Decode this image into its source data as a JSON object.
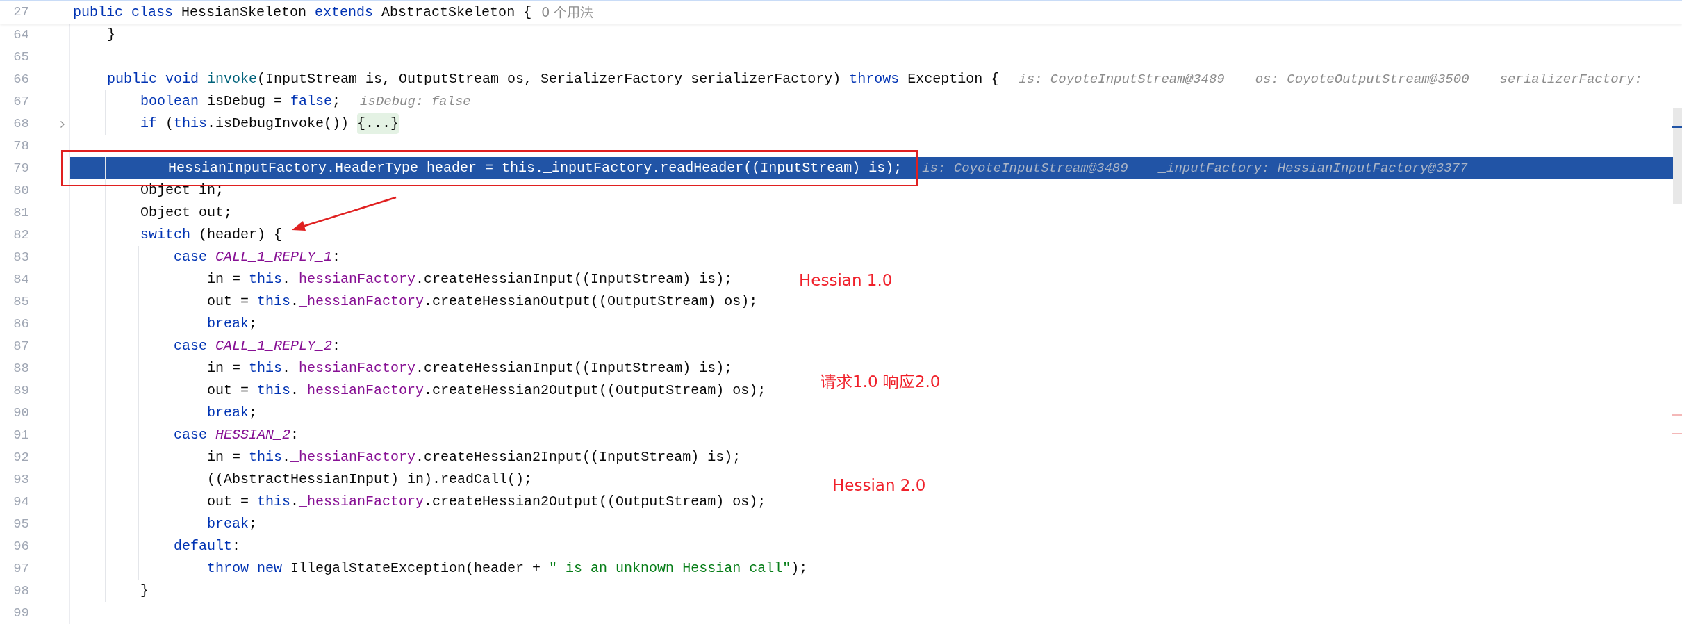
{
  "sticky_line": {
    "number": "27",
    "tokens": [
      {
        "kind": "kw",
        "text": "public class"
      },
      {
        "kind": "plain",
        "text": " HessianSkeleton "
      },
      {
        "kind": "kw",
        "text": "extends"
      },
      {
        "kind": "plain",
        "text": " AbstractSkeleton {"
      }
    ],
    "usages": "0 个用法"
  },
  "lines": [
    {
      "number": "64",
      "current": false,
      "foldable": false,
      "tokens": [
        {
          "kind": "plain",
          "text": "    }"
        }
      ]
    },
    {
      "number": "65",
      "current": false,
      "foldable": false
    },
    {
      "number": "66",
      "current": false,
      "foldable": false,
      "tokens": [
        {
          "kind": "kw",
          "text": "    public void "
        },
        {
          "kind": "decl",
          "text": "invoke"
        },
        {
          "kind": "plain",
          "text": "(InputStream is, OutputStream os, SerializerFactory serializerFactory) "
        },
        {
          "kind": "kw",
          "text": "throws"
        },
        {
          "kind": "plain",
          "text": " Exception {"
        }
      ],
      "hints": [
        "is: CoyoteInputStream@3489",
        "os: CoyoteOutputStream@3500",
        "serializerFactory:"
      ]
    },
    {
      "number": "67",
      "current": false,
      "foldable": false,
      "tokens": [
        {
          "kind": "kw",
          "text": "        boolean"
        },
        {
          "kind": "plain",
          "text": " isDebug = "
        },
        {
          "kind": "kw",
          "text": "false"
        },
        {
          "kind": "plain",
          "text": ";"
        }
      ],
      "hints": [
        "isDebug: false"
      ]
    },
    {
      "number": "68",
      "current": false,
      "foldable": true,
      "tokens": [
        {
          "kind": "kw",
          "text": "        if"
        },
        {
          "kind": "plain",
          "text": " ("
        },
        {
          "kind": "kw",
          "text": "this"
        },
        {
          "kind": "plain",
          "text": ".isDebugInvoke()) "
        },
        {
          "kind": "fold",
          "text": "{...}"
        }
      ]
    },
    {
      "number": "78",
      "current": false,
      "foldable": false
    },
    {
      "number": "79",
      "current": true,
      "foldable": false,
      "tokens": [
        {
          "kind": "plain",
          "text": "        HessianInputFactory.HeaderType header = "
        },
        {
          "kind": "kw",
          "text": "this"
        },
        {
          "kind": "plain",
          "text": "."
        },
        {
          "kind": "field",
          "text": "_inputFactory"
        },
        {
          "kind": "plain",
          "text": ".readHeader((InputStream) is);"
        }
      ],
      "hints": [
        "is: CoyoteInputStream@3489",
        "_inputFactory: HessianInputFactory@3377"
      ]
    },
    {
      "number": "80",
      "current": false,
      "foldable": false,
      "tokens": [
        {
          "kind": "plain",
          "text": "        Object in;"
        }
      ]
    },
    {
      "number": "81",
      "current": false,
      "foldable": false,
      "tokens": [
        {
          "kind": "plain",
          "text": "        Object out;"
        }
      ]
    },
    {
      "number": "82",
      "current": false,
      "foldable": false,
      "tokens": [
        {
          "kind": "kw",
          "text": "        switch"
        },
        {
          "kind": "plain",
          "text": " (header) {"
        }
      ]
    },
    {
      "number": "83",
      "current": false,
      "foldable": false,
      "tokens": [
        {
          "kind": "kw",
          "text": "            case "
        },
        {
          "kind": "const",
          "text": "CALL_1_REPLY_1"
        },
        {
          "kind": "plain",
          "text": ":"
        }
      ]
    },
    {
      "number": "84",
      "current": false,
      "foldable": false,
      "tokens": [
        {
          "kind": "plain",
          "text": "                in = "
        },
        {
          "kind": "kw",
          "text": "this"
        },
        {
          "kind": "plain",
          "text": "."
        },
        {
          "kind": "field",
          "text": "_hessianFactory"
        },
        {
          "kind": "plain",
          "text": ".createHessianInput((InputStream) is);"
        }
      ]
    },
    {
      "number": "85",
      "current": false,
      "foldable": false,
      "tokens": [
        {
          "kind": "plain",
          "text": "                out = "
        },
        {
          "kind": "kw",
          "text": "this"
        },
        {
          "kind": "plain",
          "text": "."
        },
        {
          "kind": "field",
          "text": "_hessianFactory"
        },
        {
          "kind": "plain",
          "text": ".createHessianOutput((OutputStream) os);"
        }
      ]
    },
    {
      "number": "86",
      "current": false,
      "foldable": false,
      "tokens": [
        {
          "kind": "kw",
          "text": "                break"
        },
        {
          "kind": "plain",
          "text": ";"
        }
      ]
    },
    {
      "number": "87",
      "current": false,
      "foldable": false,
      "tokens": [
        {
          "kind": "kw",
          "text": "            case "
        },
        {
          "kind": "const",
          "text": "CALL_1_REPLY_2"
        },
        {
          "kind": "plain",
          "text": ":"
        }
      ]
    },
    {
      "number": "88",
      "current": false,
      "foldable": false,
      "tokens": [
        {
          "kind": "plain",
          "text": "                in = "
        },
        {
          "kind": "kw",
          "text": "this"
        },
        {
          "kind": "plain",
          "text": "."
        },
        {
          "kind": "field",
          "text": "_hessianFactory"
        },
        {
          "kind": "plain",
          "text": ".createHessianInput((InputStream) is);"
        }
      ]
    },
    {
      "number": "89",
      "current": false,
      "foldable": false,
      "tokens": [
        {
          "kind": "plain",
          "text": "                out = "
        },
        {
          "kind": "kw",
          "text": "this"
        },
        {
          "kind": "plain",
          "text": "."
        },
        {
          "kind": "field",
          "text": "_hessianFactory"
        },
        {
          "kind": "plain",
          "text": ".createHessian2Output((OutputStream) os);"
        }
      ]
    },
    {
      "number": "90",
      "current": false,
      "foldable": false,
      "tokens": [
        {
          "kind": "kw",
          "text": "                break"
        },
        {
          "kind": "plain",
          "text": ";"
        }
      ]
    },
    {
      "number": "91",
      "current": false,
      "foldable": false,
      "tokens": [
        {
          "kind": "kw",
          "text": "            case "
        },
        {
          "kind": "const",
          "text": "HESSIAN_2"
        },
        {
          "kind": "plain",
          "text": ":"
        }
      ]
    },
    {
      "number": "92",
      "current": false,
      "foldable": false,
      "tokens": [
        {
          "kind": "plain",
          "text": "                in = "
        },
        {
          "kind": "kw",
          "text": "this"
        },
        {
          "kind": "plain",
          "text": "."
        },
        {
          "kind": "field",
          "text": "_hessianFactory"
        },
        {
          "kind": "plain",
          "text": ".createHessian2Input((InputStream) is);"
        }
      ]
    },
    {
      "number": "93",
      "current": false,
      "foldable": false,
      "tokens": [
        {
          "kind": "plain",
          "text": "                ((AbstractHessianInput) in).readCall();"
        }
      ]
    },
    {
      "number": "94",
      "current": false,
      "foldable": false,
      "tokens": [
        {
          "kind": "plain",
          "text": "                out = "
        },
        {
          "kind": "kw",
          "text": "this"
        },
        {
          "kind": "plain",
          "text": "."
        },
        {
          "kind": "field",
          "text": "_hessianFactory"
        },
        {
          "kind": "plain",
          "text": ".createHessian2Output((OutputStream) os);"
        }
      ]
    },
    {
      "number": "95",
      "current": false,
      "foldable": false,
      "tokens": [
        {
          "kind": "kw",
          "text": "                break"
        },
        {
          "kind": "plain",
          "text": ";"
        }
      ]
    },
    {
      "number": "96",
      "current": false,
      "foldable": false,
      "tokens": [
        {
          "kind": "kw",
          "text": "            default"
        },
        {
          "kind": "plain",
          "text": ":"
        }
      ]
    },
    {
      "number": "97",
      "current": false,
      "foldable": false,
      "tokens": [
        {
          "kind": "kw",
          "text": "                throw new"
        },
        {
          "kind": "plain",
          "text": " IllegalStateException(header + "
        },
        {
          "kind": "str",
          "text": "\" is an unknown Hessian call\""
        },
        {
          "kind": "plain",
          "text": ");"
        }
      ]
    },
    {
      "number": "98",
      "current": false,
      "foldable": false,
      "tokens": [
        {
          "kind": "plain",
          "text": "        }"
        }
      ]
    },
    {
      "number": "99",
      "current": false,
      "foldable": false
    }
  ],
  "annotations": [
    {
      "text": "Hessian 1.0"
    },
    {
      "text": "请求1.0 响应2.0"
    },
    {
      "text": "Hessian 2.0"
    }
  ]
}
